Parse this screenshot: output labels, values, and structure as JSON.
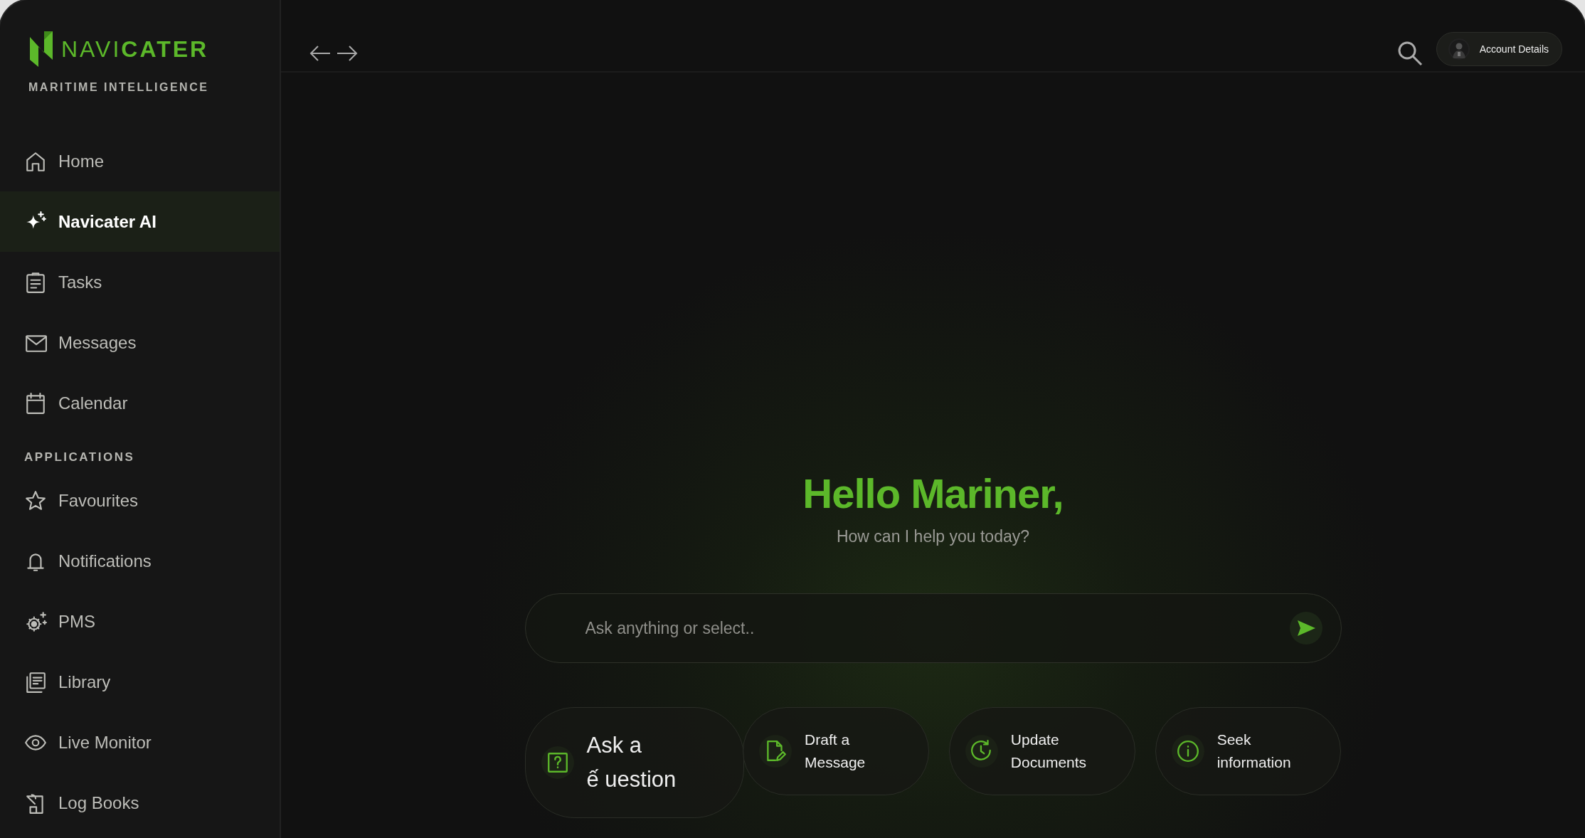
{
  "sidebar": {
    "logo": {
      "light": "NAVI",
      "bold": "CATER"
    },
    "tagline": "MARITIME INTELLIGENCE",
    "items": [
      {
        "label": "Home",
        "selected": false
      },
      {
        "label": "Navicater AI",
        "selected": true
      },
      {
        "label": "Tasks",
        "selected": false
      },
      {
        "label": "Messages",
        "selected": false
      },
      {
        "label": "Calendar",
        "selected": false
      }
    ],
    "section": "APPLICATIONS",
    "apps": [
      {
        "label": "Favourites",
        "selected": false
      },
      {
        "label": "Notifications",
        "selected": false
      },
      {
        "label": "PMS",
        "selected": false
      },
      {
        "label": "Library",
        "selected": false
      },
      {
        "label": "Live Monitor",
        "selected": false
      },
      {
        "label": "Log Books",
        "selected": false
      }
    ]
  },
  "topbar": {
    "account": "Account Details"
  },
  "greeting": {
    "title": "Hello Mariner,",
    "subtitle": "How can I help you today?"
  },
  "prompt": {
    "placeholder": "Ask anything or select.."
  },
  "suggestions": [
    {
      "kind": "large",
      "label": "Ask a ế uestion"
    },
    {
      "kind": "normal",
      "label": "Draft a Message"
    },
    {
      "kind": "normal",
      "label": "Update Documents"
    },
    {
      "kind": "normal",
      "label": "Seek information"
    }
  ]
}
